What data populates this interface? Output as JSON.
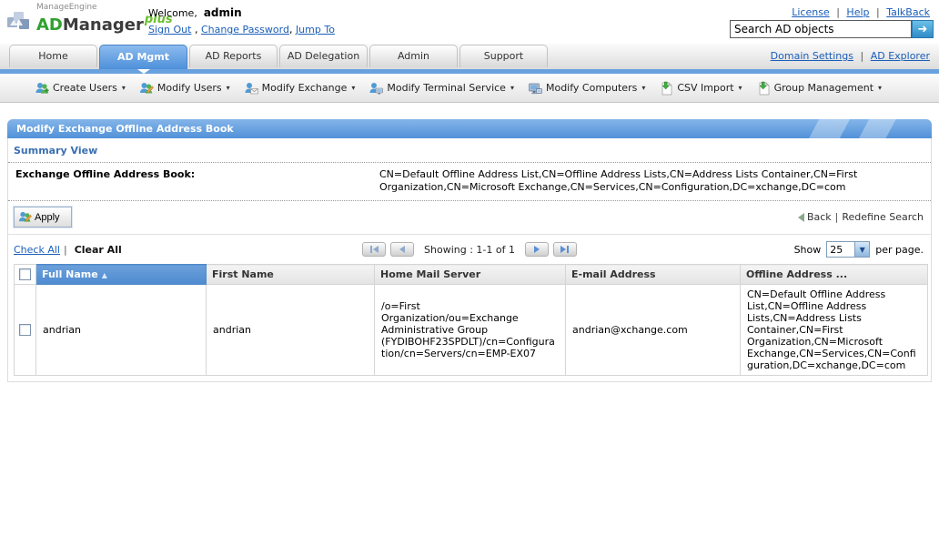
{
  "glyphs": {
    "pipe": "|",
    "comma": ",",
    "caret": "▾",
    "sort_asc": "▲",
    "search_arrow": "➜",
    "dropdown_arrow": "▼"
  },
  "colors": {
    "accent_blue": "#5191d8",
    "stripe_blue": "#69a1de",
    "link_blue": "#1a5eb8",
    "brand_green": "#2fa12f",
    "table_sorted_header": "#5e97d4"
  },
  "header": {
    "brand": {
      "company": "ManageEngine",
      "ad": "AD",
      "manager": "Manager",
      "plus": "plus"
    },
    "welcome_label": "Welcome,",
    "username": "admin",
    "session_links": [
      "Sign Out",
      "Change Password",
      "Jump To"
    ],
    "utility_links": [
      "License",
      "Help",
      "TalkBack"
    ],
    "search": {
      "value": "Search AD objects"
    }
  },
  "tabs": {
    "items": [
      {
        "label": "Home"
      },
      {
        "label": "AD Mgmt",
        "active": true
      },
      {
        "label": "AD Reports"
      },
      {
        "label": "AD Delegation"
      },
      {
        "label": "Admin"
      },
      {
        "label": "Support"
      }
    ],
    "right_links": [
      "Domain Settings",
      "AD Explorer"
    ]
  },
  "toolbar": {
    "items": [
      {
        "label": "Create Users",
        "icon": "create-users-icon"
      },
      {
        "label": "Modify Users",
        "icon": "modify-users-icon"
      },
      {
        "label": "Modify Exchange",
        "icon": "modify-exchange-icon"
      },
      {
        "label": "Modify Terminal Service",
        "icon": "modify-terminal-service-icon"
      },
      {
        "label": "Modify Computers",
        "icon": "modify-computers-icon"
      },
      {
        "label": "CSV Import",
        "icon": "csv-import-icon"
      },
      {
        "label": "Group Management",
        "icon": "group-management-icon"
      }
    ]
  },
  "panel": {
    "title": "Modify Exchange Offline Address Book",
    "section_title": "Summary View",
    "summary": {
      "label": "Exchange Offline Address Book:",
      "value": "CN=Default Offline Address List,CN=Offline Address Lists,CN=Address Lists Container,CN=First Organization,CN=Microsoft Exchange,CN=Services,CN=Configuration,DC=xchange,DC=com"
    },
    "actions": {
      "apply": "Apply",
      "back": "Back",
      "redefine": "Redefine Search"
    },
    "selection": {
      "check_all": "Check All",
      "clear_all": "Clear All"
    },
    "paging": {
      "showing": "Showing : 1-1 of 1",
      "show_label": "Show",
      "page_size": "25",
      "per_page": "per page."
    },
    "table": {
      "columns": [
        "Full Name",
        "First Name",
        "Home Mail Server",
        "E-mail Address",
        "Offline Address ..."
      ],
      "rows": [
        {
          "full_name": "andrian",
          "first_name": "andrian",
          "home_mail_server": "/o=First Organization/ou=Exchange Administrative Group (FYDIBOHF23SPDLT)/cn=Configuration/cn=Servers/cn=EMP-EX07",
          "email": "andrian@xchange.com",
          "offline_address": "CN=Default Offline Address List,CN=Offline Address Lists,CN=Address Lists Container,CN=First Organization,CN=Microsoft Exchange,CN=Services,CN=Configuration,DC=xchange,DC=com"
        }
      ]
    }
  }
}
